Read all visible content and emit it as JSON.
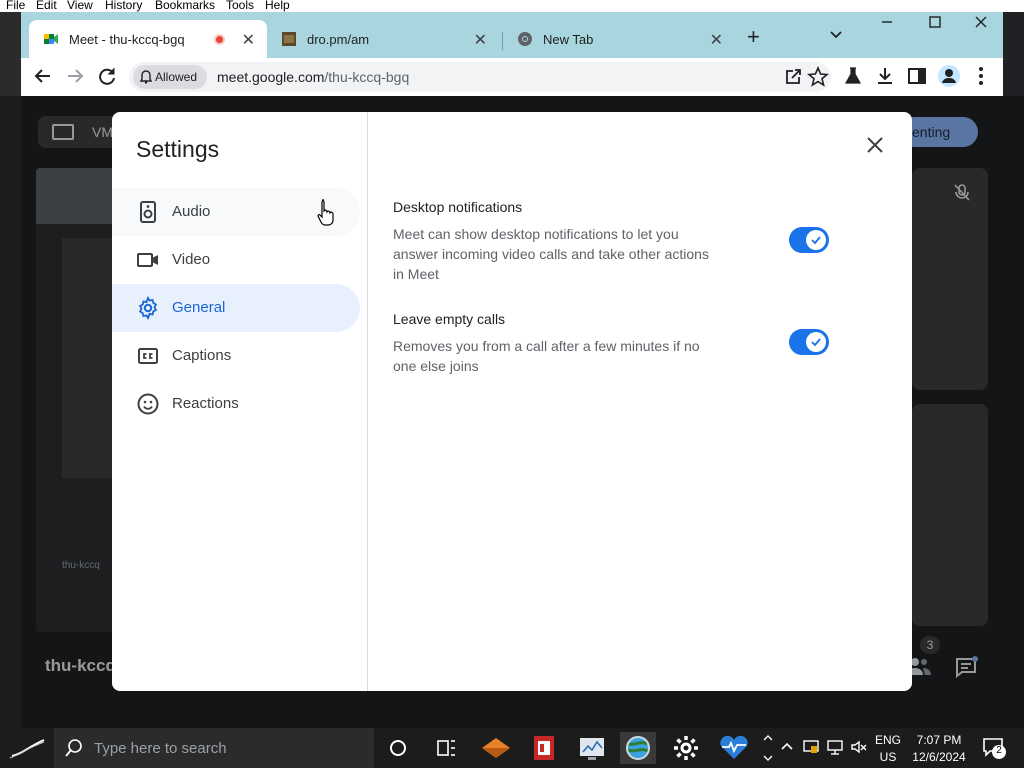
{
  "host_menu": [
    "File",
    "Edit",
    "View",
    "History",
    "Bookmarks",
    "Tools",
    "Help"
  ],
  "meet_background": {
    "present_label": "VM",
    "stop_presenting_label": "enting",
    "meeting_code": "thu-kccq",
    "participant_count": "3",
    "mini_label": "thu-kccq"
  },
  "browser": {
    "tabs": [
      {
        "title": "Meet - thu-kccq-bgq",
        "active": true,
        "recording": true
      },
      {
        "title": "dro.pm/am",
        "active": false
      },
      {
        "title": "New Tab",
        "active": false
      }
    ],
    "permission_chip": "Allowed",
    "url_host": "meet.google.com",
    "url_path": "/thu-kccq-bgq"
  },
  "settings": {
    "title": "Settings",
    "nav": [
      {
        "label": "Audio",
        "icon": "speaker-icon"
      },
      {
        "label": "Video",
        "icon": "videocam-icon"
      },
      {
        "label": "General",
        "icon": "gear-icon",
        "selected": true
      },
      {
        "label": "Captions",
        "icon": "closed-captions-icon"
      },
      {
        "label": "Reactions",
        "icon": "smiley-icon"
      }
    ],
    "options": [
      {
        "title": "Desktop notifications",
        "description": "Meet can show desktop notifications to let you answer incoming video calls and take other actions in Meet",
        "enabled": true
      },
      {
        "title": "Leave empty calls",
        "description": "Removes you from a call after a few minutes if no one else joins",
        "enabled": true
      }
    ]
  },
  "taskbar": {
    "search_placeholder": "Type here to search",
    "language_top": "ENG",
    "language_bottom": "US",
    "time": "7:07 PM",
    "date": "12/6/2024",
    "notification_count": "2"
  },
  "colors": {
    "accent": "#1a73e8",
    "selected_nav_bg": "#e8f0fe",
    "selected_nav_text": "#1967d2",
    "tabstrip": "#a9d5de",
    "recording": "#ea4335"
  }
}
